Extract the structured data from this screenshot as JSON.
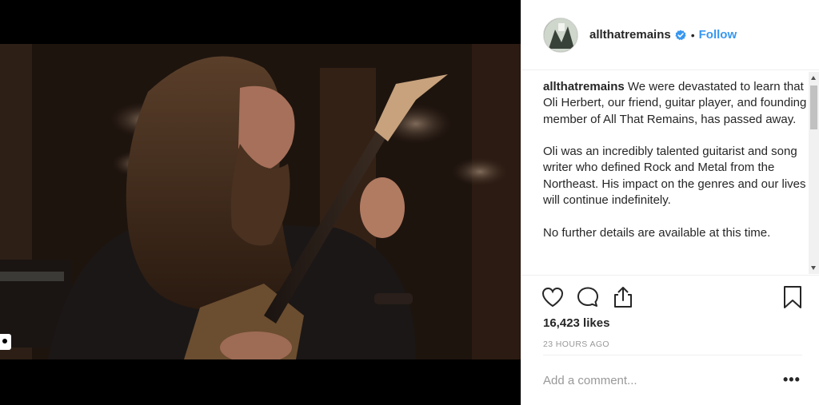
{
  "post": {
    "media_type": "video",
    "author": {
      "username": "allthatremains",
      "verified": true,
      "verified_icon": "verified-badge-icon",
      "avatar_icon": "avatar"
    },
    "header": {
      "separator": "•",
      "follow_label": "Follow"
    },
    "caption": {
      "username": "allthatremains",
      "paragraphs": [
        "We were devastated to learn that Oli Herbert, our friend, guitar player, and founding member of All That Remains, has passed away.",
        "Oli was an incredibly talented guitarist and song writer who defined Rock and Metal from the Northeast. His impact on the genres and our lives will continue indefinitely.",
        "No further details are available at this time."
      ]
    },
    "actions": {
      "icons": [
        "heart-icon",
        "comment-icon",
        "share-icon",
        "bookmark-icon"
      ]
    },
    "likes": "16,423 likes",
    "timestamp": "23 HOURS AGO",
    "comment": {
      "placeholder": "Add a comment...",
      "more_label": "•••"
    }
  },
  "colors": {
    "link": "#3897f0",
    "text": "#262626",
    "muted": "#999999",
    "divider": "#efefef"
  }
}
